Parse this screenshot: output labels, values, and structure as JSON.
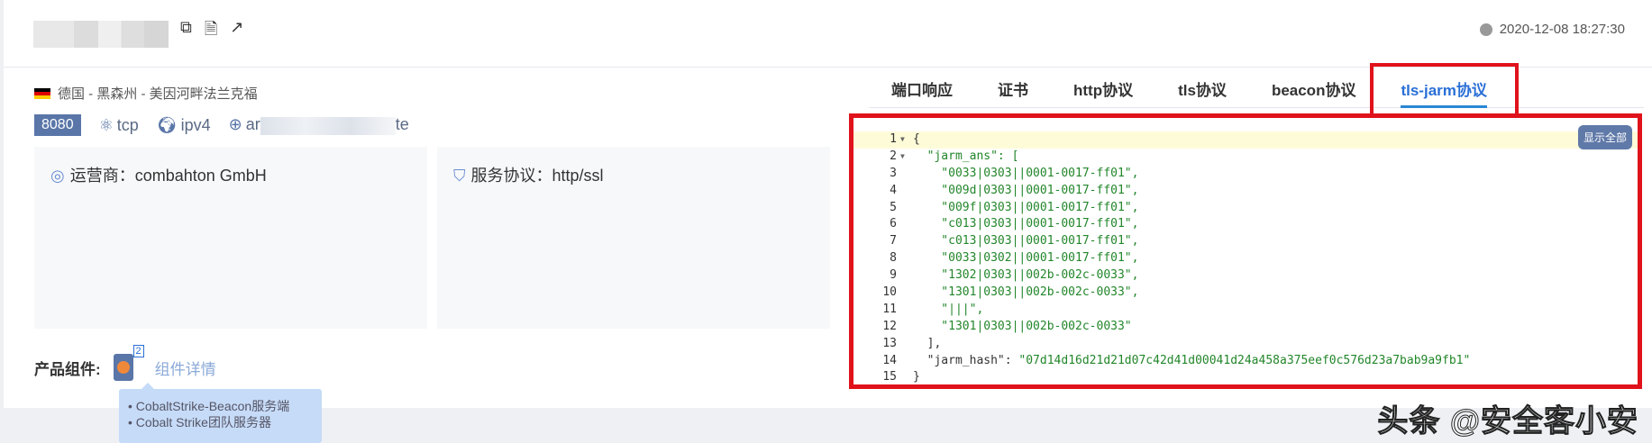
{
  "header": {
    "timestamp": "2020-12-08 18:27:30",
    "icons": [
      "copy-icon",
      "document-icon",
      "external-link-icon"
    ]
  },
  "location": "德国 - 黑森州 - 美因河畔法兰克福",
  "port": "8080",
  "protocol": "tcp",
  "ip_version": "ipv4",
  "host_prefix": "ar",
  "host_suffix": "te",
  "cards": {
    "operator": "运营商：combahton GmbH",
    "service": "服务协议：http/ssl"
  },
  "product": {
    "label": "产品组件:",
    "count": "2",
    "details_link": "组件详情",
    "tooltip": [
      "CobaltStrike-Beacon服务端",
      "Cobalt Strike团队服务器"
    ]
  },
  "tabs": [
    "端口响应",
    "证书",
    "http协议",
    "tls协议",
    "beacon协议",
    "tls-jarm协议"
  ],
  "active_tab": "tls-jarm协议",
  "show_all": "显示全部",
  "code_lines": [
    "{",
    "  \"jarm_ans\": [",
    "    \"0033|0303||0001-0017-ff01\",",
    "    \"009d|0303||0001-0017-ff01\",",
    "    \"009f|0303||0001-0017-ff01\",",
    "    \"c013|0303||0001-0017-ff01\",",
    "    \"c013|0303||0001-0017-ff01\",",
    "    \"0033|0302||0001-0017-ff01\",",
    "    \"1302|0303||002b-002c-0033\",",
    "    \"1301|0303||002b-002c-0033\",",
    "    \"|||\",",
    "    \"1301|0303||002b-002c-0033\"",
    "  ],",
    "  \"jarm_hash\": \"07d14d16d21d21d07c42d41d00041d24a458a375eef0c576d23a7bab9a9fb1\"",
    "}"
  ],
  "watermark": "头条 @安全客小安"
}
